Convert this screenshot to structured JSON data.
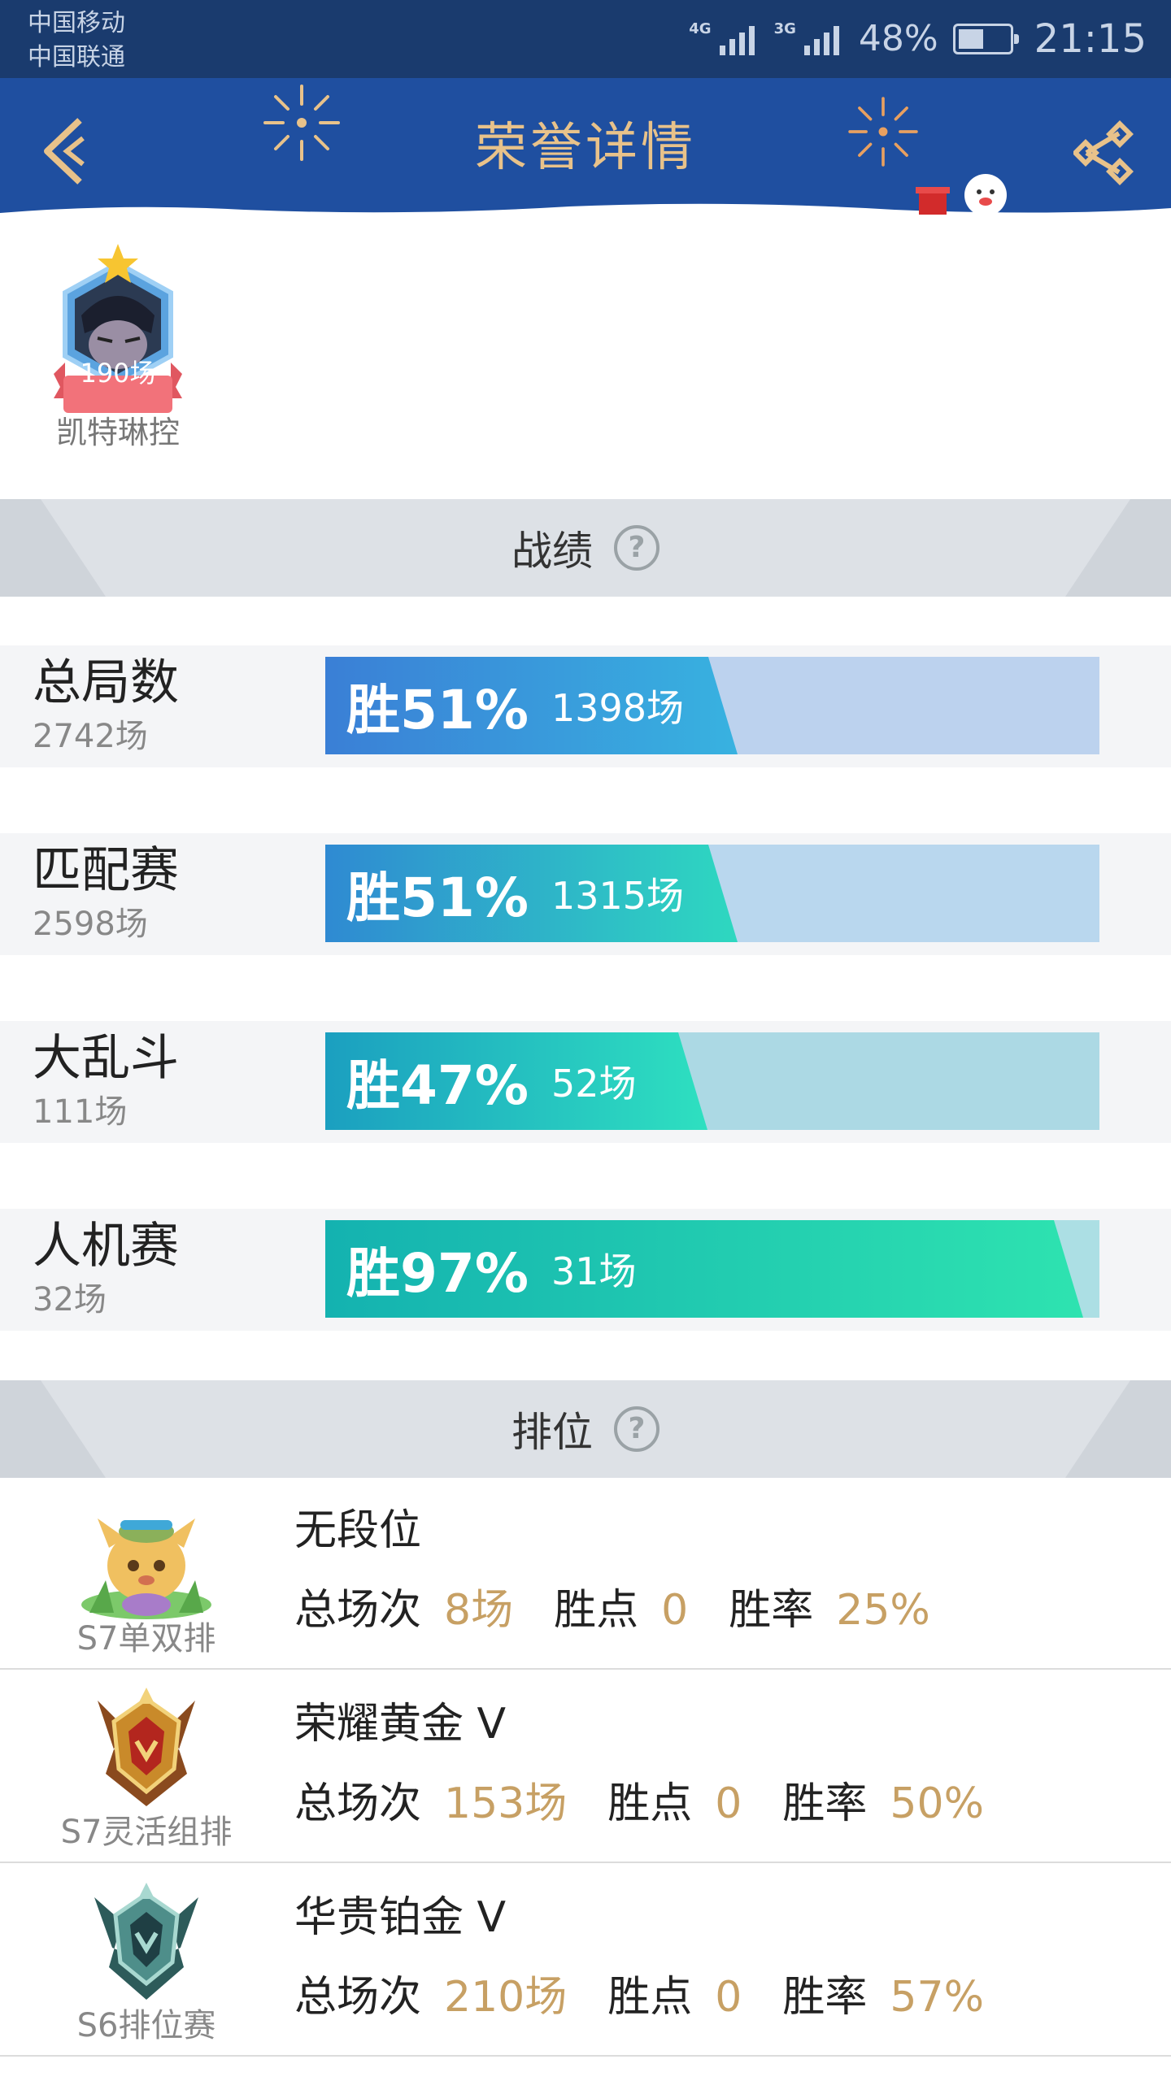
{
  "status_bar": {
    "carrier_1": "中国移动",
    "carrier_2": "中国联通",
    "net_1": "4G",
    "net_2": "3G",
    "battery": "48%",
    "time": "21:15"
  },
  "header": {
    "title": "荣誉详情",
    "back_icon": "chevron-left-icon",
    "share_icon": "share-icon",
    "accent_color": "#e8c28a",
    "background_color": "#1f4fa0"
  },
  "hero": {
    "games_badge": "190场",
    "name": "凯特琳控",
    "badge_color": "#f2727a"
  },
  "records_section": {
    "title": "战绩",
    "help_icon": "question-circle-icon",
    "rows": [
      {
        "name": "总局数",
        "total": "2742场",
        "win_label": "胜51%",
        "wins": "1398场",
        "win_rate": 0.51
      },
      {
        "name": "匹配赛",
        "total": "2598场",
        "win_label": "胜51%",
        "wins": "1315场",
        "win_rate": 0.51
      },
      {
        "name": "大乱斗",
        "total": "111场",
        "win_label": "胜47%",
        "wins": "52场",
        "win_rate": 0.47
      },
      {
        "name": "人机赛",
        "total": "32场",
        "win_label": "胜97%",
        "wins": "31场",
        "win_rate": 0.97
      }
    ]
  },
  "ranked_section": {
    "title": "排位",
    "help_icon": "question-circle-icon",
    "labels": {
      "games": "总场次",
      "points": "胜点",
      "rate": "胜率"
    },
    "value_color": "#c7a064",
    "rows": [
      {
        "season": "S7单双排",
        "tier": "无段位",
        "games": "8场",
        "points": "0",
        "rate": "25%",
        "icon": "teemo-unranked-icon"
      },
      {
        "season": "S7灵活组排",
        "tier": "荣耀黄金 V",
        "games": "153场",
        "points": "0",
        "rate": "50%",
        "icon": "gold-tier-emblem-icon"
      },
      {
        "season": "S6排位赛",
        "tier": "华贵铂金 V",
        "games": "210场",
        "points": "0",
        "rate": "57%",
        "icon": "platinum-tier-emblem-icon"
      }
    ]
  }
}
